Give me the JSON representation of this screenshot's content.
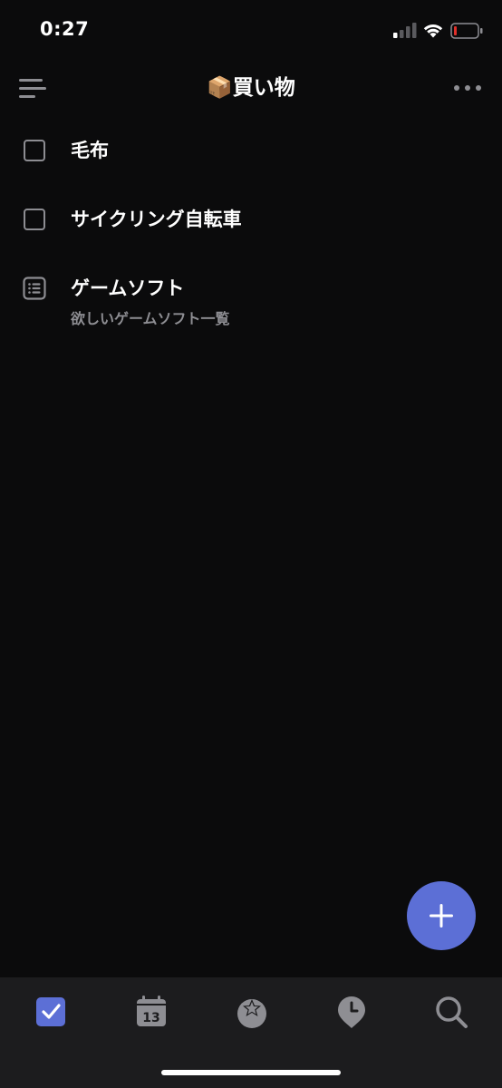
{
  "status_bar": {
    "time": "0:27",
    "battery_color": "#e0302a"
  },
  "header": {
    "title": "📦買い物",
    "menu_icon": "hamburger-menu-icon",
    "more_icon": "ellipsis-icon"
  },
  "tasks": [
    {
      "title": "毛布",
      "type": "checkbox",
      "checked": false
    },
    {
      "title": "サイクリング自転車",
      "type": "checkbox",
      "checked": false
    },
    {
      "title": "ゲームソフト",
      "type": "note",
      "note": "欲しいゲームソフト一覧"
    }
  ],
  "fab": {
    "icon": "plus-icon",
    "color": "#5c6fd6"
  },
  "tab_bar": {
    "tabs": [
      {
        "name": "tasks",
        "icon": "checkbox-check-icon",
        "active": true
      },
      {
        "name": "calendar",
        "icon": "calendar-icon",
        "day": "13",
        "active": false
      },
      {
        "name": "habit",
        "icon": "star-badge-icon",
        "active": false
      },
      {
        "name": "focus",
        "icon": "clock-pin-icon",
        "active": false
      },
      {
        "name": "search",
        "icon": "search-icon",
        "active": false
      }
    ],
    "accent_color": "#5c6fd6",
    "inactive_color": "#8e8e93"
  }
}
